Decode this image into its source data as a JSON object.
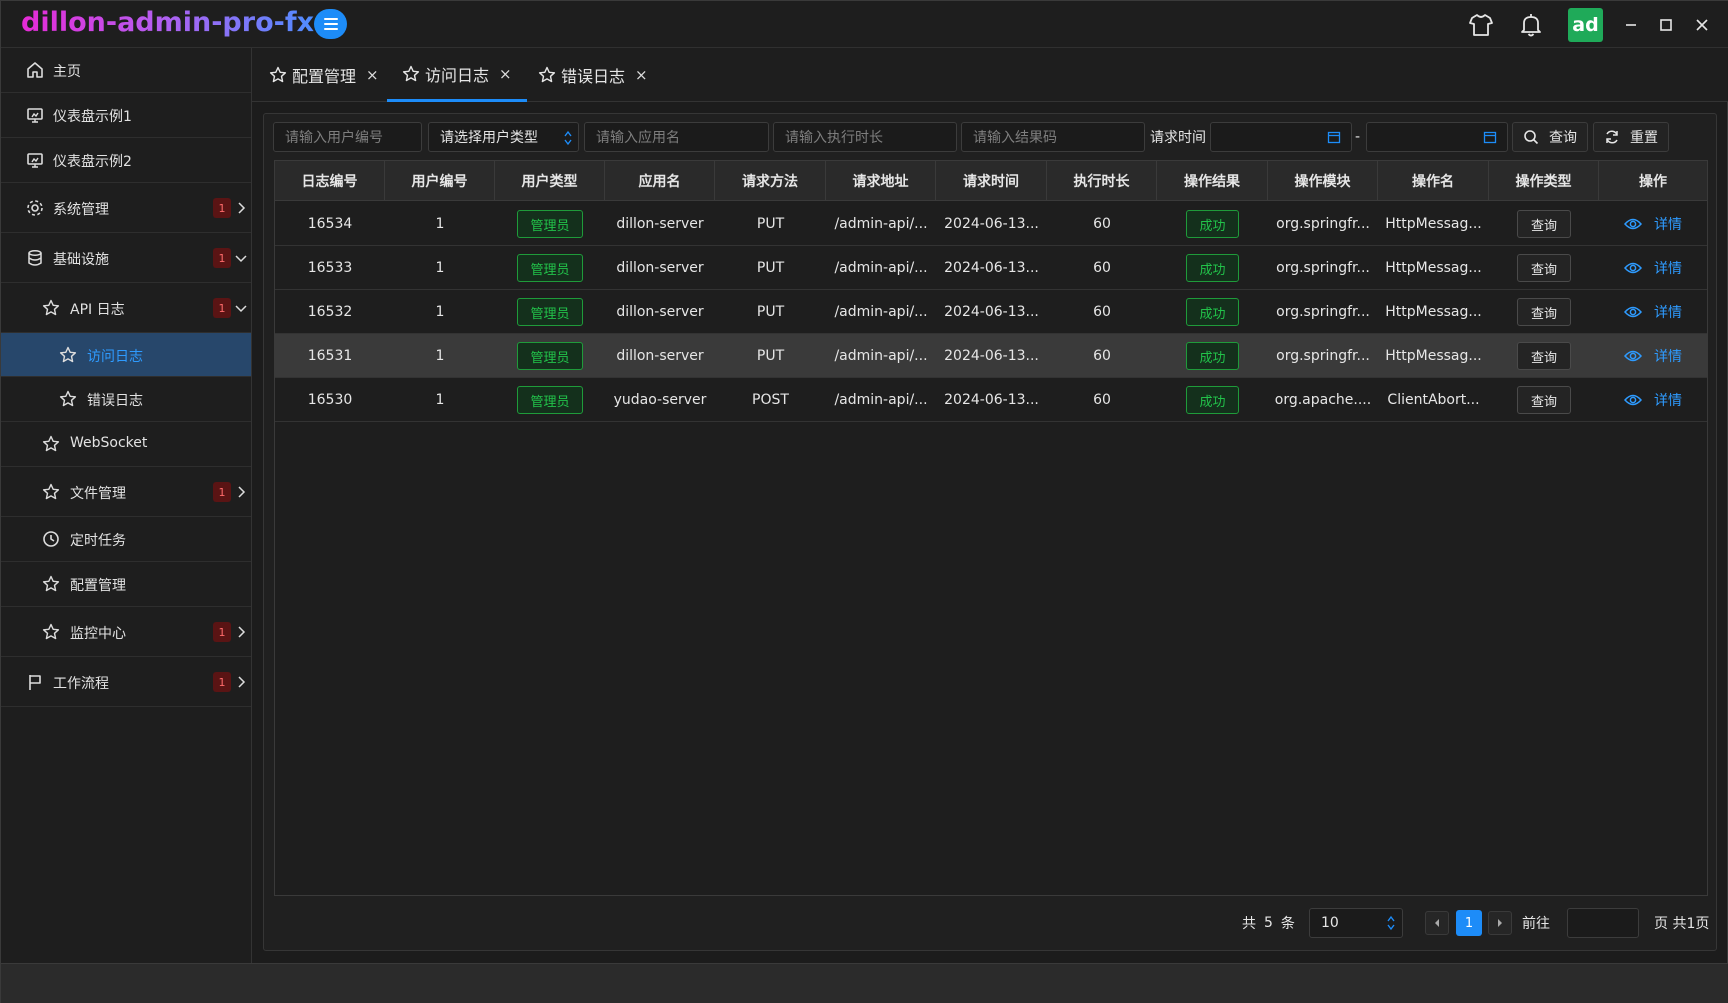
{
  "app": {
    "title": "dillon-admin-pro-fx",
    "avatar_text": "ad",
    "accent_color": "#1d8cf8",
    "success_color": "#22c24a"
  },
  "titlebar_icons": [
    "menu-icon",
    "tshirt-icon",
    "bell-icon",
    "minimize-icon",
    "maximize-icon",
    "close-icon"
  ],
  "sidebar": {
    "items": [
      {
        "label": "主页",
        "icon": "home-icon"
      },
      {
        "label": "仪表盘示例1",
        "icon": "monitor-icon"
      },
      {
        "label": "仪表盘示例2",
        "icon": "monitor-icon"
      },
      {
        "label": "系统管理",
        "icon": "gear-icon",
        "badge": "1"
      },
      {
        "label": "基础设施",
        "icon": "database-icon",
        "badge": "1"
      },
      {
        "label": "API 日志",
        "icon": "star-icon",
        "badge": "1"
      },
      {
        "label": "访问日志",
        "icon": "star-icon"
      },
      {
        "label": "错误日志",
        "icon": "star-icon"
      },
      {
        "label": "WebSocket",
        "icon": "star-icon"
      },
      {
        "label": "文件管理",
        "icon": "star-icon",
        "badge": "1"
      },
      {
        "label": "定时任务",
        "icon": "clock-icon"
      },
      {
        "label": "配置管理",
        "icon": "star-icon"
      },
      {
        "label": "监控中心",
        "icon": "star-icon",
        "badge": "1"
      },
      {
        "label": "工作流程",
        "icon": "flag-icon",
        "badge": "1"
      }
    ]
  },
  "tabs": [
    {
      "label": "配置管理",
      "close": "×"
    },
    {
      "label": "访问日志",
      "close": "×"
    },
    {
      "label": "错误日志",
      "close": "×"
    }
  ],
  "filters": {
    "user_id_placeholder": "请输入用户编号",
    "user_type_select": "请选择用户类型",
    "app_name_placeholder": "请输入应用名",
    "duration_placeholder": "请输入执行时长",
    "result_code_placeholder": "请输入结果码",
    "request_time_label": "请求时间",
    "date_separator": "-",
    "search_label": "查询",
    "reset_label": "重置"
  },
  "table": {
    "headers": [
      "日志编号",
      "用户编号",
      "用户类型",
      "应用名",
      "请求方法",
      "请求地址",
      "请求时间",
      "执行时长",
      "操作结果",
      "操作模块",
      "操作名",
      "操作类型",
      "操作"
    ],
    "rows": [
      {
        "id": "16534",
        "user_id": "1",
        "user_type": "管理员",
        "app": "dillon-server",
        "method": "PUT",
        "url": "/admin-api/...",
        "time": "2024-06-13...",
        "duration": "60",
        "result": "成功",
        "module": "org.springfr...",
        "name": "HttpMessag...",
        "op_type": "查询",
        "action": "详情"
      },
      {
        "id": "16533",
        "user_id": "1",
        "user_type": "管理员",
        "app": "dillon-server",
        "method": "PUT",
        "url": "/admin-api/...",
        "time": "2024-06-13...",
        "duration": "60",
        "result": "成功",
        "module": "org.springfr...",
        "name": "HttpMessag...",
        "op_type": "查询",
        "action": "详情"
      },
      {
        "id": "16532",
        "user_id": "1",
        "user_type": "管理员",
        "app": "dillon-server",
        "method": "PUT",
        "url": "/admin-api/...",
        "time": "2024-06-13...",
        "duration": "60",
        "result": "成功",
        "module": "org.springfr...",
        "name": "HttpMessag...",
        "op_type": "查询",
        "action": "详情"
      },
      {
        "id": "16531",
        "user_id": "1",
        "user_type": "管理员",
        "app": "dillon-server",
        "method": "PUT",
        "url": "/admin-api/...",
        "time": "2024-06-13...",
        "duration": "60",
        "result": "成功",
        "module": "org.springfr...",
        "name": "HttpMessag...",
        "op_type": "查询",
        "action": "详情"
      },
      {
        "id": "16530",
        "user_id": "1",
        "user_type": "管理员",
        "app": "yudao-server",
        "method": "POST",
        "url": "/admin-api/...",
        "time": "2024-06-13...",
        "duration": "60",
        "result": "成功",
        "module": "org.apache....",
        "name": "ClientAbort...",
        "op_type": "查询",
        "action": "详情"
      }
    ]
  },
  "pagination": {
    "total_prefix": "共",
    "total": "5",
    "total_suffix": "条",
    "page_size": "10",
    "current_page": "1",
    "goto_label": "前往",
    "page_suffix": "页 共1页"
  }
}
